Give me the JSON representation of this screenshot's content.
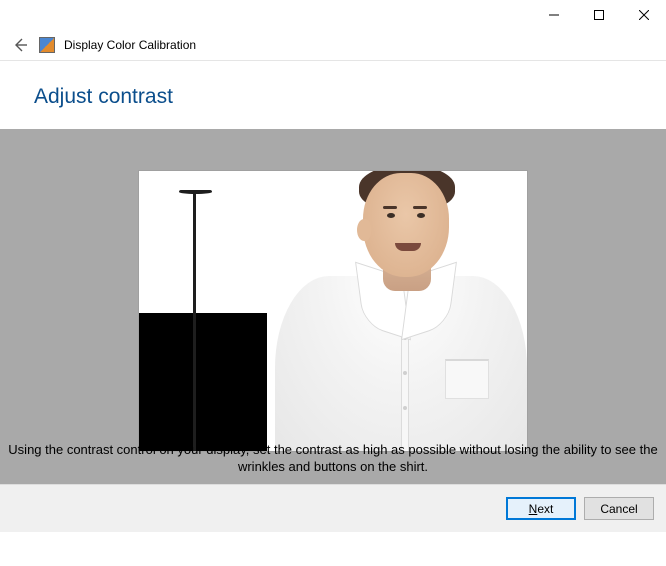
{
  "window": {
    "title": "Display Color Calibration"
  },
  "page": {
    "heading": "Adjust contrast",
    "instruction": "Using the contrast control on your display, set the contrast as high as possible without losing the ability to see the wrinkles and buttons on the shirt."
  },
  "buttons": {
    "next": "Next",
    "cancel": "Cancel"
  }
}
